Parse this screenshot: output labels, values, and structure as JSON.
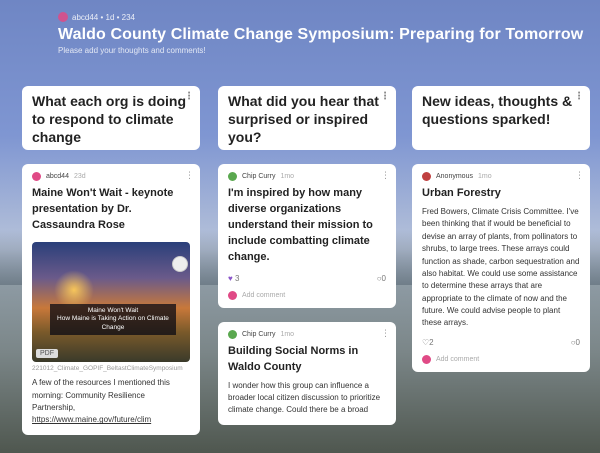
{
  "header": {
    "meta": "abcd44 • 1d • 234",
    "title": "Waldo County Climate Change Symposium: Preparing for Tomorrow",
    "subtitle": "Please add your thoughts and comments!"
  },
  "columns": [
    {
      "heading": "What each org is doing to respond to climate change"
    },
    {
      "heading": "What did you hear that surprised or inspired you?"
    },
    {
      "heading": "New ideas, thoughts & questions sparked!"
    }
  ],
  "cards": {
    "c1": {
      "author": "abcd44",
      "time": "23d",
      "title": "Maine Won't Wait - keynote presentation by Dr. Cassaundra Rose",
      "attachment_caption_1": "Maine Won't Wait",
      "attachment_caption_2": "How Maine is Taking Action on Climate Change",
      "pdf": "PDF",
      "filename": "221012_Climate_GOPIF_BeltastClimateSymposium",
      "body": "A few of the resources I mentioned this morning: Community Resilience Partnership,",
      "link": "https://www.maine.gov/future/clim"
    },
    "c2": {
      "author": "Chip Curry",
      "time": "1mo",
      "title": "I'm inspired by how many diverse organizations understand their mission to include combatting climate change.",
      "likes": "3",
      "comments": "0",
      "add_comment": "Add comment"
    },
    "c3": {
      "author": "Chip Curry",
      "time": "1mo",
      "title": "Building Social Norms in Waldo County",
      "body": "I wonder how this group can influence a broader local citizen discussion to prioritize climate change.  Could there be a broad"
    },
    "c4": {
      "author": "Anonymous",
      "time": "1mo",
      "title": "Urban Forestry",
      "body": "Fred Bowers, Climate Crisis Committee. I've been thinking that if would be beneficial to devise an array of plants, from pollinators to shrubs, to large trees. These arrays could function as shade, carbon sequestration and also habitat. We could use some assistance to determine these arrays that are appropriate to the climate of now and the future. We could advise people to plant these arrays.",
      "likes": "2",
      "comments": "0",
      "add_comment": "Add comment"
    }
  },
  "colors": {
    "accent": "#e04a86",
    "green": "#5aa84f",
    "heart": "#8a55c9"
  }
}
